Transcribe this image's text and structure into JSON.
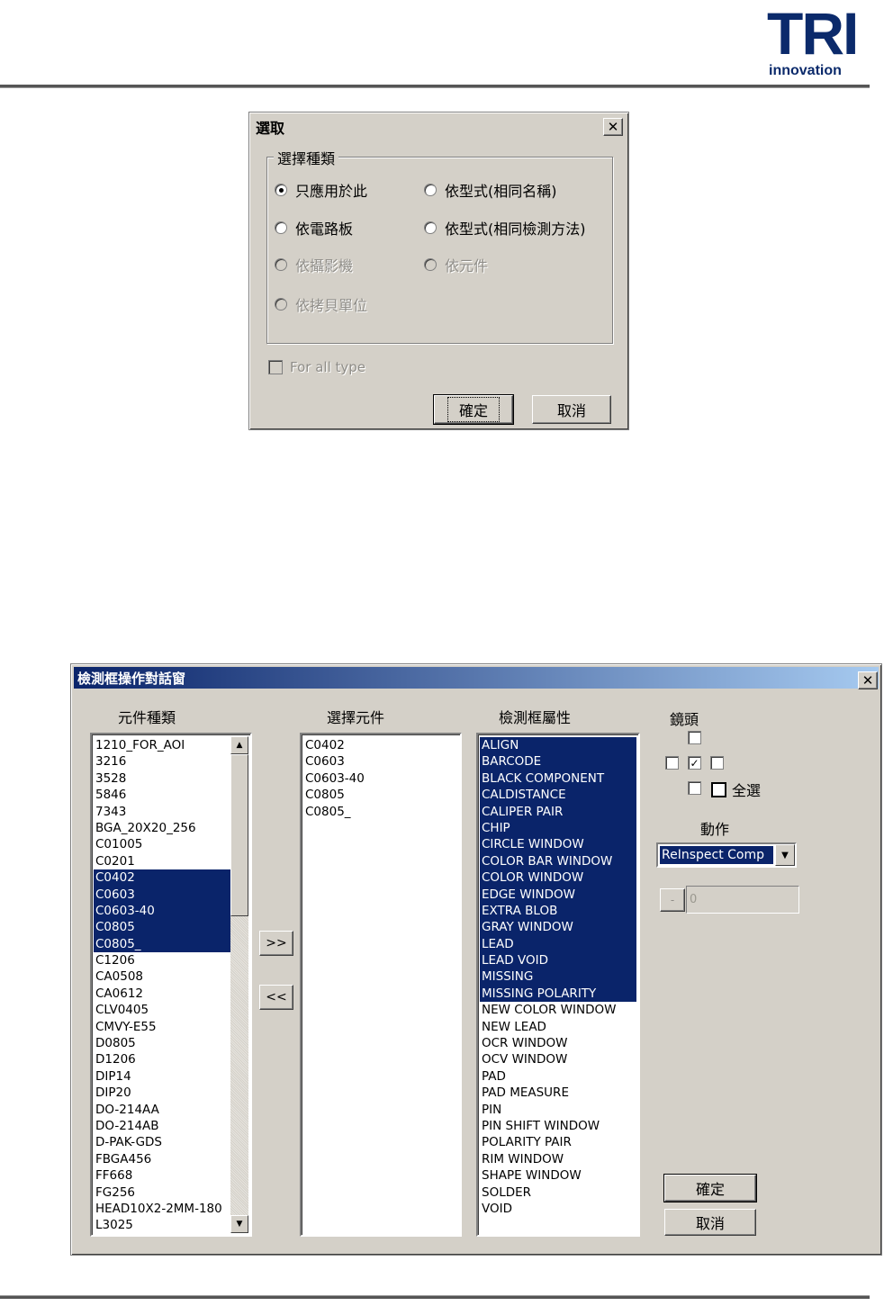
{
  "logo": {
    "letters": "TRI",
    "sub": "innovation"
  },
  "select_dialog": {
    "title": "選取",
    "group_label": "選擇種類",
    "options": [
      {
        "label": "只應用於此",
        "checked": true,
        "enabled": true
      },
      {
        "label": "依型式(相同名稱)",
        "checked": false,
        "enabled": true
      },
      {
        "label": "依電路板",
        "checked": false,
        "enabled": true
      },
      {
        "label": "依型式(相同檢測方法)",
        "checked": false,
        "enabled": true
      },
      {
        "label": "依攝影機",
        "checked": false,
        "enabled": false
      },
      {
        "label": "依元件",
        "checked": false,
        "enabled": false
      },
      {
        "label": "依拷貝單位",
        "checked": false,
        "enabled": false
      }
    ],
    "for_all_type": "For all type",
    "ok_label": "確定",
    "cancel_label": "取消"
  },
  "window_dialog": {
    "title": "檢測框操作對話窗",
    "headers": {
      "component_types": "元件種類",
      "selected": "選擇元件",
      "properties": "檢測框屬性",
      "lens": "鏡頭",
      "action": "動作"
    },
    "component_types": [
      {
        "name": "1210_FOR_AOI",
        "sel": false
      },
      {
        "name": "3216",
        "sel": false
      },
      {
        "name": "3528",
        "sel": false
      },
      {
        "name": "5846",
        "sel": false
      },
      {
        "name": "7343",
        "sel": false
      },
      {
        "name": "BGA_20X20_256",
        "sel": false
      },
      {
        "name": "C01005",
        "sel": false
      },
      {
        "name": "C0201",
        "sel": false
      },
      {
        "name": "C0402",
        "sel": true
      },
      {
        "name": "C0603",
        "sel": true
      },
      {
        "name": "C0603-40",
        "sel": true
      },
      {
        "name": "C0805",
        "sel": true
      },
      {
        "name": "C0805_",
        "sel": true
      },
      {
        "name": "C1206",
        "sel": false
      },
      {
        "name": "CA0508",
        "sel": false
      },
      {
        "name": "CA0612",
        "sel": false
      },
      {
        "name": "CLV0405",
        "sel": false
      },
      {
        "name": "CMVY-E55",
        "sel": false
      },
      {
        "name": "D0805",
        "sel": false
      },
      {
        "name": "D1206",
        "sel": false
      },
      {
        "name": "DIP14",
        "sel": false
      },
      {
        "name": "DIP20",
        "sel": false
      },
      {
        "name": "DO-214AA",
        "sel": false
      },
      {
        "name": "DO-214AB",
        "sel": false
      },
      {
        "name": "D-PAK-GDS",
        "sel": false
      },
      {
        "name": "FBGA456",
        "sel": false
      },
      {
        "name": "FF668",
        "sel": false
      },
      {
        "name": "FG256",
        "sel": false
      },
      {
        "name": "HEAD10X2-2MM-180",
        "sel": false
      },
      {
        "name": "L3025",
        "sel": false
      }
    ],
    "selected_components": [
      "C0402",
      "C0603",
      "C0603-40",
      "C0805",
      "C0805_"
    ],
    "properties": [
      {
        "name": "ALIGN",
        "sel": true
      },
      {
        "name": "BARCODE",
        "sel": true
      },
      {
        "name": "BLACK COMPONENT",
        "sel": true
      },
      {
        "name": "CALDISTANCE",
        "sel": true
      },
      {
        "name": "CALIPER PAIR",
        "sel": true
      },
      {
        "name": "CHIP",
        "sel": true
      },
      {
        "name": "CIRCLE WINDOW",
        "sel": true
      },
      {
        "name": "COLOR BAR WINDOW",
        "sel": true
      },
      {
        "name": "COLOR WINDOW",
        "sel": true
      },
      {
        "name": "EDGE WINDOW",
        "sel": true
      },
      {
        "name": "EXTRA BLOB",
        "sel": true
      },
      {
        "name": "GRAY WINDOW",
        "sel": true
      },
      {
        "name": "LEAD",
        "sel": true
      },
      {
        "name": "LEAD VOID",
        "sel": true
      },
      {
        "name": "MISSING",
        "sel": true
      },
      {
        "name": "MISSING POLARITY",
        "sel": true
      },
      {
        "name": "NEW COLOR WINDOW",
        "sel": false
      },
      {
        "name": "NEW LEAD",
        "sel": false
      },
      {
        "name": "OCR WINDOW",
        "sel": false
      },
      {
        "name": "OCV WINDOW",
        "sel": false
      },
      {
        "name": "PAD",
        "sel": false
      },
      {
        "name": "PAD MEASURE",
        "sel": false
      },
      {
        "name": "PIN",
        "sel": false
      },
      {
        "name": "PIN SHIFT WINDOW",
        "sel": false
      },
      {
        "name": "POLARITY PAIR",
        "sel": false
      },
      {
        "name": "RIM WINDOW",
        "sel": false
      },
      {
        "name": "SHAPE WINDOW",
        "sel": false
      },
      {
        "name": "SOLDER",
        "sel": false
      },
      {
        "name": "VOID",
        "sel": false
      }
    ],
    "add_label": ">>",
    "remove_label": "<<",
    "lens_center_checked": true,
    "select_all_label": "全選",
    "action_value": "ReInspect Comp",
    "minus_label": "-",
    "value_text": "0",
    "ok_label": "確定",
    "cancel_label": "取消"
  },
  "colors": {
    "selection": "#0a246a",
    "dialog_bg": "#d4d0c8",
    "logo": "#0b2a6b"
  }
}
